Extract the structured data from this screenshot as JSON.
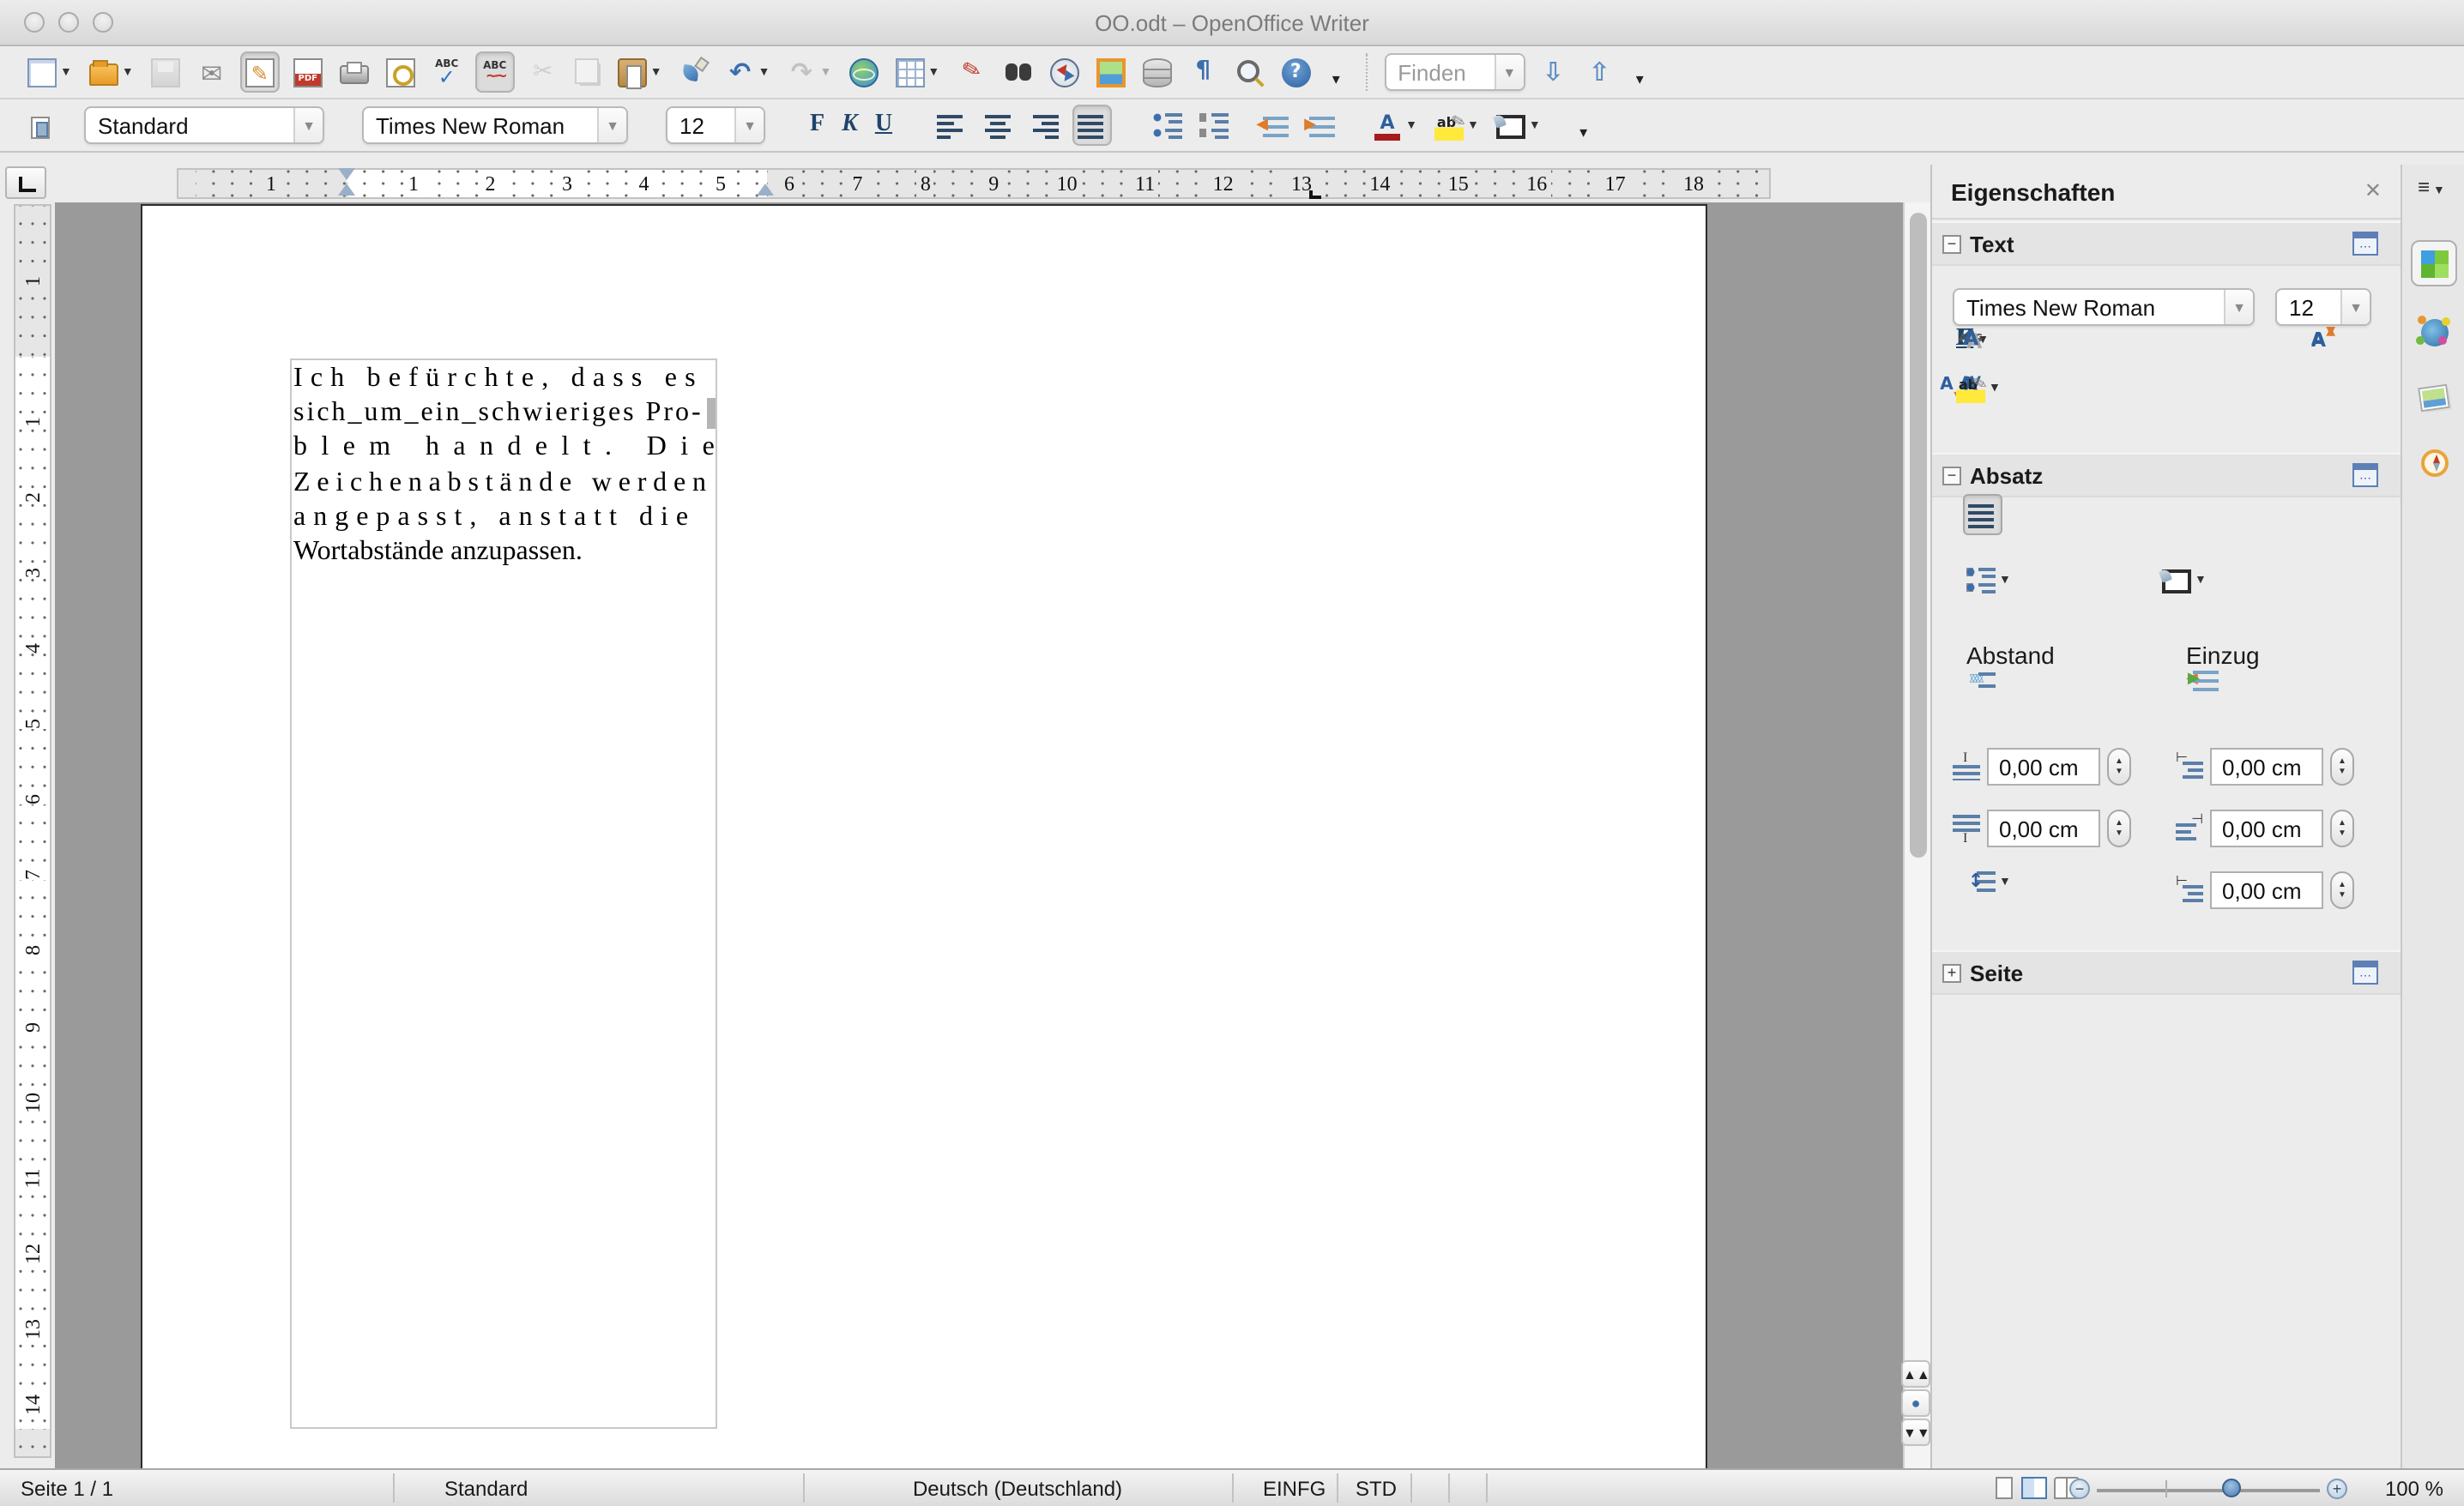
{
  "window": {
    "title": "OO.odt – OpenOffice Writer"
  },
  "toolbar_main": {
    "items": [
      {
        "name": "new-document-button",
        "shape": "doc",
        "dropdown": true
      },
      {
        "name": "open-button",
        "shape": "folder",
        "dropdown": true
      },
      {
        "name": "save-button",
        "shape": "disk",
        "disabled": true
      },
      {
        "name": "email-document-button",
        "shape": "mail"
      },
      {
        "name": "edit-file-button",
        "shape": "editdoc",
        "active": true
      },
      {
        "name": "export-pdf-button",
        "shape": "pdf"
      },
      {
        "name": "print-button",
        "shape": "print"
      },
      {
        "name": "page-preview-button",
        "shape": "preview"
      },
      {
        "name": "spellcheck-button",
        "shape": "abc-check"
      },
      {
        "name": "autospellcheck-button",
        "shape": "abc-auto",
        "active": true
      },
      {
        "name": "cut-button",
        "shape": "cut",
        "disabled": true
      },
      {
        "name": "copy-button",
        "shape": "copy",
        "disabled": true
      },
      {
        "name": "paste-button",
        "shape": "paste",
        "dropdown": true
      },
      {
        "name": "format-paintbrush-button",
        "shape": "brush"
      },
      {
        "name": "undo-button",
        "shape": "undo",
        "dropdown": true
      },
      {
        "name": "redo-button",
        "shape": "redo",
        "disabled": true,
        "dropdown": true
      },
      {
        "name": "hyperlink-button",
        "shape": "globe"
      },
      {
        "name": "insert-table-button",
        "shape": "table",
        "dropdown": true
      },
      {
        "name": "draw-functions-button",
        "shape": "draw"
      },
      {
        "name": "find-replace-button",
        "shape": "binoc"
      },
      {
        "name": "navigator-button",
        "shape": "compass"
      },
      {
        "name": "gallery-button",
        "shape": "picture"
      },
      {
        "name": "data-sources-button",
        "shape": "db"
      },
      {
        "name": "formatting-marks-button",
        "shape": "pilcrow"
      },
      {
        "name": "zoom-button",
        "shape": "zoomglass"
      },
      {
        "name": "help-button",
        "shape": "help"
      },
      {
        "name": "toolbar-overflow-button",
        "shape": "overflow"
      },
      {
        "sep": true
      },
      {
        "name": "find-combobox",
        "combo": "Finden",
        "width": 82,
        "placeholder": true
      },
      {
        "name": "find-next-button",
        "shape": "down-arrow"
      },
      {
        "name": "find-previous-button",
        "shape": "up-arrow"
      },
      {
        "name": "find-overflow-button",
        "shape": "overflow"
      }
    ]
  },
  "toolbar_format": {
    "items": [
      {
        "name": "fill-format-button",
        "shape": "fillformat"
      },
      {
        "gap": 6
      },
      {
        "name": "paragraph-style-combobox",
        "combo": "Standard",
        "width": 140
      },
      {
        "gap": 10
      },
      {
        "name": "font-name-combobox",
        "combo": "Times New Roman",
        "width": 155
      },
      {
        "gap": 10
      },
      {
        "name": "font-size-combobox",
        "combo": "12",
        "width": 58
      },
      {
        "gap": 12
      },
      {
        "name": "bold-button",
        "label": "F",
        "cls": "lbl-bold"
      },
      {
        "name": "italic-button",
        "label": "K",
        "cls": "lbl-italic"
      },
      {
        "name": "underline-button",
        "label": "U",
        "cls": "lbl-underline"
      },
      {
        "gap": 10
      },
      {
        "name": "align-left-button",
        "shape": "al-left"
      },
      {
        "name": "align-center-button",
        "shape": "al-center"
      },
      {
        "name": "align-right-button",
        "shape": "al-right"
      },
      {
        "name": "align-justify-button",
        "shape": "al-just",
        "active": true
      },
      {
        "gap": 10
      },
      {
        "name": "numbered-list-button",
        "shape": "numlist"
      },
      {
        "name": "bullet-list-button",
        "shape": "bullist"
      },
      {
        "gap": 2
      },
      {
        "name": "decrease-indent-button",
        "shape": "ind-dec"
      },
      {
        "name": "increase-indent-button",
        "shape": "ind-inc"
      },
      {
        "gap": 6
      },
      {
        "name": "font-color-button",
        "shape": "fontcolor",
        "dropdown": true
      },
      {
        "name": "highlighting-button",
        "shape": "highlight",
        "dropdown": true
      },
      {
        "name": "background-color-button",
        "shape": "bgcolor",
        "dropdown": true
      },
      {
        "gap": 4
      },
      {
        "name": "toolbar2-overflow-button",
        "shape": "overflow"
      }
    ]
  },
  "ruler": {
    "h_margin_numbers": [
      "1"
    ],
    "h_text_numbers": [
      "1",
      "2",
      "3",
      "4",
      "5"
    ],
    "h_after_numbers": [
      "6",
      "7",
      "8",
      "9",
      "10",
      "11",
      "12",
      "13",
      "14",
      "15",
      "16",
      "17",
      "18"
    ],
    "v_margin_numbers": [
      "1"
    ],
    "v_text_numbers": [
      "1",
      "2",
      "3",
      "4",
      "5",
      "6",
      "7",
      "8",
      "9",
      "10",
      "11",
      "12",
      "13",
      "14"
    ]
  },
  "document": {
    "lines": [
      "Ich befürchte, dass es",
      "sich_um_ein_schwieriges Pro-",
      "blem handelt.  Die",
      "Zeichenabstände werden",
      "angepasst, anstatt die",
      "Wortabstände anzupassen."
    ]
  },
  "sidebar": {
    "title": "Eigenschaften",
    "close_glyph": "✕",
    "text_section": {
      "label": "Text",
      "font_name": "Times New Roman",
      "font_size": "12",
      "bold_label": "F",
      "italic_label": "K",
      "underline_label": "U"
    },
    "paragraph_section": {
      "label": "Absatz",
      "spacing_label": "Abstand",
      "indent_label": "Einzug",
      "spacing_fields": [
        {
          "name": "spacing-above-field",
          "value": "0,00 cm",
          "icon": "fi-above"
        },
        {
          "name": "spacing-below-field",
          "value": "0,00 cm",
          "icon": "fi-below"
        }
      ],
      "indent_fields": [
        {
          "name": "indent-before-field",
          "value": "0,00 cm",
          "icon": "fi-before"
        },
        {
          "name": "indent-after-field",
          "value": "0,00 cm",
          "icon": "fi-after"
        },
        {
          "name": "indent-firstline-field",
          "value": "0,00 cm",
          "icon": "fi-first"
        }
      ]
    },
    "page_section": {
      "label": "Seite"
    }
  },
  "statusbar": {
    "page_indicator": "Seite 1 / 1",
    "page_style": "Standard",
    "language": "Deutsch (Deutschland)",
    "insert_mode": "EINFG",
    "selection_mode": "STD",
    "zoom_level": "100 %"
  },
  "colors": {
    "accent_blue": "#3a6fae",
    "workspace_gray": "#9a9a9a",
    "highlight_yellow": "#ffe93a",
    "font_color_red": "#a61c1c"
  }
}
